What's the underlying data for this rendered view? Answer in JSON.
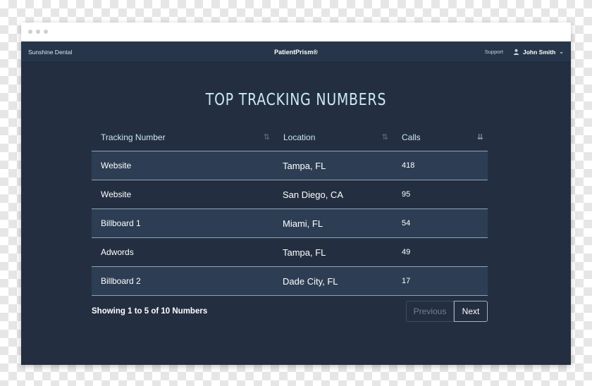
{
  "app": {
    "clinic_name": "Sunshine Dental",
    "product_name": "PatientPrism®",
    "support_label": "Support",
    "user_name": "John Smith"
  },
  "page": {
    "title": "TOP TRACKING NUMBERS"
  },
  "table": {
    "columns": [
      {
        "label": "Tracking Number",
        "sortable": true,
        "sorted": false
      },
      {
        "label": "Location",
        "sortable": true,
        "sorted": false
      },
      {
        "label": "Calls",
        "sortable": true,
        "sorted": true
      }
    ],
    "rows": [
      {
        "tracking_number": "Website",
        "location": "Tampa, FL",
        "calls": "418"
      },
      {
        "tracking_number": "Website",
        "location": "San Diego, CA",
        "calls": "95"
      },
      {
        "tracking_number": "Billboard 1",
        "location": "Miami, FL",
        "calls": "54"
      },
      {
        "tracking_number": "Adwords",
        "location": "Tampa, FL",
        "calls": "49"
      },
      {
        "tracking_number": "Billboard 2",
        "location": "Dade City, FL",
        "calls": "17"
      }
    ]
  },
  "pagination": {
    "summary": "Showing 1 to 5 of 10 Numbers",
    "previous_label": "Previous",
    "next_label": "Next"
  },
  "icons": {
    "sort": "sort-icon",
    "sort_active": "sort-descending-icon",
    "user": "user-icon",
    "chevron": "chevron-down-icon"
  },
  "colors": {
    "background": "#232f41",
    "navbar": "#26354a",
    "row_alt": "#2d3e54",
    "title": "#cbeaf7",
    "divider": "#8fa3b8"
  }
}
